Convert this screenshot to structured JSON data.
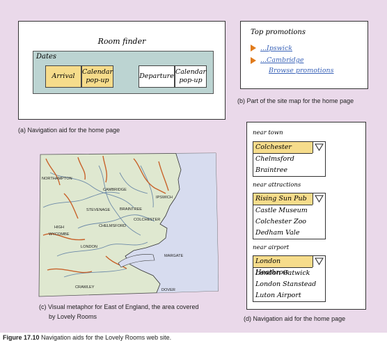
{
  "panel_a": {
    "title": "Room finder",
    "dates_label": "Dates",
    "arrival": "Arrival",
    "calendar_1": "Calendar pop-up",
    "departure": "Departure",
    "calendar_2": "Calendar pop-up",
    "caption": "(a) Navigation aid for the home page"
  },
  "panel_b": {
    "title": "Top promotions",
    "links": [
      "...Ipswick",
      "...Cambridge",
      "Browse promotions"
    ],
    "caption": "(b) Part of the site map for the home page"
  },
  "panel_c": {
    "places": [
      "NORTHAMPTON",
      "CAMBRIDGE",
      "IPSWICH",
      "STEVENAGE",
      "BRAINTREE",
      "COLCHESTER",
      "HIGH WYCOMBE",
      "CHELMSFORD",
      "LONDON",
      "MARGATE",
      "CRAWLEY",
      "DOVER"
    ],
    "caption_line1": "(c) Visual metaphor for East of England, the area covered",
    "caption_line2": "by Lovely Rooms"
  },
  "panel_d": {
    "groups": [
      {
        "label": "near town",
        "items": [
          "Colchester",
          "Chelmsford",
          "Braintree"
        ]
      },
      {
        "label": "near attractions",
        "items": [
          "Rising Sun Pub",
          "Castle Museum",
          "Colchester Zoo",
          "Dedham Vale"
        ]
      },
      {
        "label": "near airport",
        "items": [
          "London Heathrow",
          "London Gatwick",
          "London Stanstead",
          "Luton Airport"
        ]
      }
    ],
    "caption": "(d) Navigation aid for the home page"
  },
  "figure": {
    "label": "Figure 17.10",
    "text": "Navigation aids for the Lovely Rooms web site."
  },
  "colors": {
    "background": "#ead9ea",
    "highlight": "#f6dc8b",
    "dates_box": "#bcd4d2",
    "land": "#dfe8d0",
    "sea": "#d7dcef",
    "road": "#c8622a",
    "link": "#3a63b8"
  }
}
